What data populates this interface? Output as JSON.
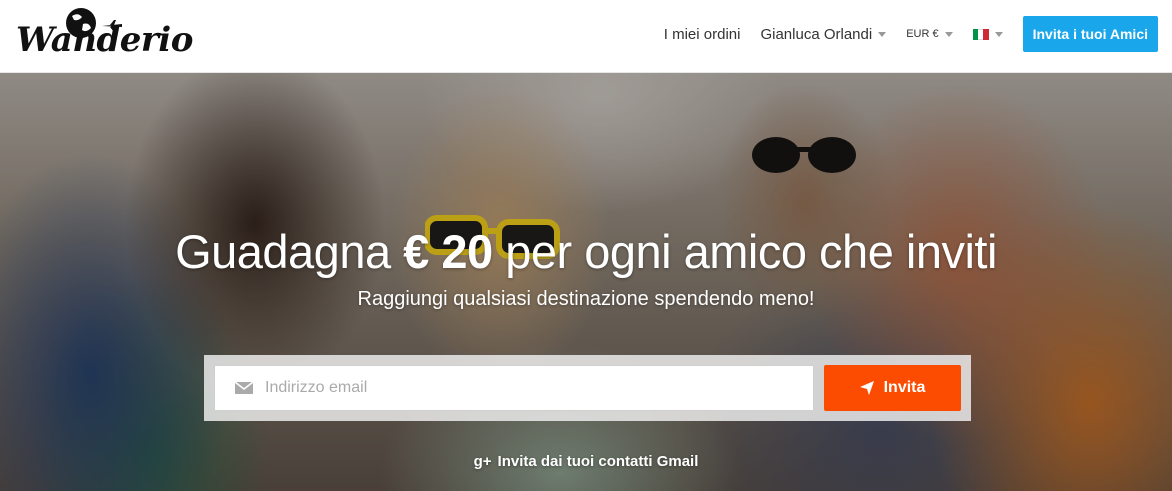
{
  "header": {
    "logo_text": "Wanderio",
    "nav": {
      "orders": "I miei ordini",
      "user": "Gianluca Orlandi",
      "currency": "EUR €",
      "language_flag": "italy-flag-icon",
      "invite_button": "Invita i tuoi Amici"
    }
  },
  "hero": {
    "title_before": "Guadagna",
    "title_amount": "€ 20",
    "title_after": "per ogni amico che inviti",
    "subtitle": "Raggiungi qualsiasi destinazione spendendo meno!",
    "email_placeholder": "Indirizzo email",
    "invite_button": "Invita",
    "gmail_link": "Invita dai tuoi contatti Gmail"
  },
  "colors": {
    "accent_blue": "#19a6ea",
    "cta_orange": "#fc4c02",
    "flag_green": "#009246",
    "flag_white": "#ffffff",
    "flag_red": "#ce2b37"
  },
  "icons": [
    "globe-icon",
    "plane-icon",
    "caret-down-icon",
    "italy-flag-icon",
    "mail-icon",
    "send-icon",
    "google-plus-icon"
  ]
}
